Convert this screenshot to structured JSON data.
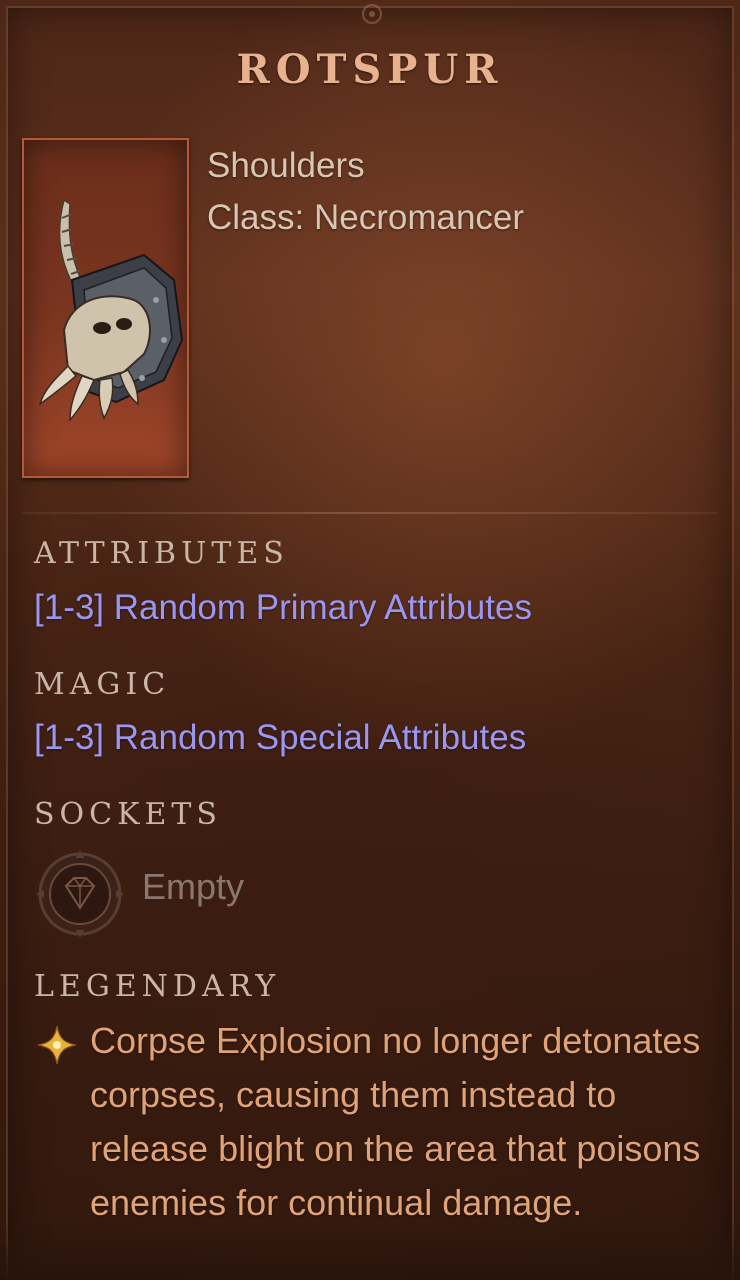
{
  "item": {
    "name": "ROTSPUR",
    "slot": "Shoulders",
    "class_line": "Class: Necromancer"
  },
  "sections": {
    "attributes": {
      "heading": "ATTRIBUTES",
      "value": "[1-3] Random Primary Attributes"
    },
    "magic": {
      "heading": "MAGIC",
      "value": "[1-3] Random Special Attributes"
    },
    "sockets": {
      "heading": "SOCKETS",
      "socket_state": "Empty",
      "icon": "gem-socket-icon"
    },
    "legendary": {
      "heading": "LEGENDARY",
      "icon": "legendary-star-icon",
      "text": "Corpse Explosion no longer detonates corpses, causing them instead to release blight on the area that poisons enemies for continual damage."
    }
  },
  "colors": {
    "name": "#e8b28e",
    "stat": "#9a96f2",
    "legendary": "#e0a377",
    "portrait_border": "#b55a34"
  }
}
